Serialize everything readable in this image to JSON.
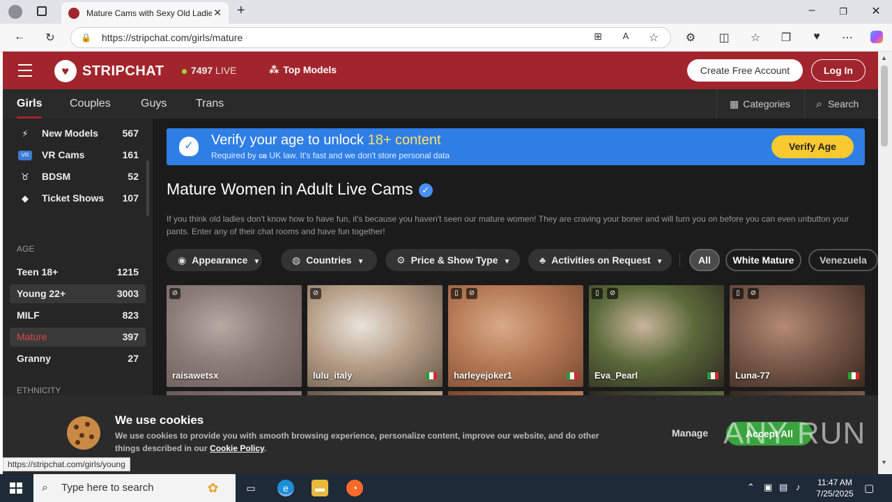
{
  "browser": {
    "tab_title": "Mature Cams with Sexy Old Ladie",
    "url": "https://stripchat.com/girls/mature",
    "status_url": "https://stripchat.com/girls/young"
  },
  "header": {
    "brand": "STRIPCHAT",
    "live_count": "7497",
    "live_label": "LIVE",
    "top_models": "Top Models",
    "create_account": "Create Free Account",
    "login": "Log In"
  },
  "catbar": {
    "tabs": [
      {
        "label": "Girls"
      },
      {
        "label": "Couples"
      },
      {
        "label": "Guys"
      },
      {
        "label": "Trans"
      }
    ],
    "categories": "Categories",
    "search": "Search"
  },
  "sidebar": {
    "special": [
      {
        "label": "New Models",
        "count": "567",
        "icon": "bolt-icon"
      },
      {
        "label": "VR Cams",
        "count": "161",
        "icon": "vr-icon"
      },
      {
        "label": "BDSM",
        "count": "52",
        "icon": "bdsm-icon"
      },
      {
        "label": "Ticket Shows",
        "count": "107",
        "icon": "ticket-icon"
      }
    ],
    "age_heading": "AGE",
    "age": [
      {
        "label": "Teen 18+",
        "count": "1215"
      },
      {
        "label": "Young 22+",
        "count": "3003"
      },
      {
        "label": "MILF",
        "count": "823"
      },
      {
        "label": "Mature",
        "count": "397"
      },
      {
        "label": "Granny",
        "count": "27"
      }
    ],
    "ethnicity_heading": "ETHNICITY"
  },
  "verify": {
    "title_prefix": "Verify your age to unlock",
    "title_highlight": "18+ content",
    "subtitle_prefix": "Required by",
    "subtitle_flag": "GB",
    "subtitle_rest": "UK law. It's fast and we don't store personal data",
    "button": "Verify Age"
  },
  "main": {
    "title": "Mature Women in Adult Live Cams",
    "description": "If you think old ladies don't know how to have fun, it's because you haven't seen our mature women! They are craving your boner and will turn you on before you can even unbutton your pants. Enter any of their chat rooms and have fun together!",
    "filters": [
      {
        "label": "Appearance",
        "icon": "eye-icon"
      },
      {
        "label": "Countries",
        "icon": "globe-icon"
      },
      {
        "label": "Price & Show Type",
        "icon": "price-icon"
      },
      {
        "label": "Activities on Request",
        "icon": "activities-icon"
      }
    ],
    "pills": [
      "All",
      "White Mature",
      "Venezuela"
    ]
  },
  "models": [
    {
      "name": "raisawetsx",
      "flag": "",
      "mobile": false,
      "colors": [
        "#8a7a78",
        "#b9a9a3",
        "#6a5c58"
      ]
    },
    {
      "name": "lulu_italy",
      "flag": "it",
      "mobile": false,
      "colors": [
        "#b7a089",
        "#e9e3dc",
        "#6a5a4a"
      ]
    },
    {
      "name": "harleyejoker1",
      "flag": "it",
      "mobile": true,
      "colors": [
        "#b57a55",
        "#d8a987",
        "#7a4a33"
      ]
    },
    {
      "name": "Eva_Pearl",
      "flag": "it",
      "mobile": true,
      "colors": [
        "#5b6a3a",
        "#c9b49b",
        "#2f2a22"
      ]
    },
    {
      "name": "Luna-77",
      "flag": "it",
      "mobile": true,
      "colors": [
        "#7a5a4a",
        "#b48a72",
        "#3a2820"
      ]
    }
  ],
  "cookie": {
    "title": "We use cookies",
    "text": "We use cookies to provide you with smooth browsing experience, personalize content, improve our website, and do other things described in our",
    "link": "Cookie Policy",
    "manage": "Manage",
    "accept": "Accept All",
    "watermark": "ANY RUN"
  },
  "taskbar": {
    "search_placeholder": "Type here to search",
    "time": "11:47 AM",
    "date": "7/25/2025"
  }
}
